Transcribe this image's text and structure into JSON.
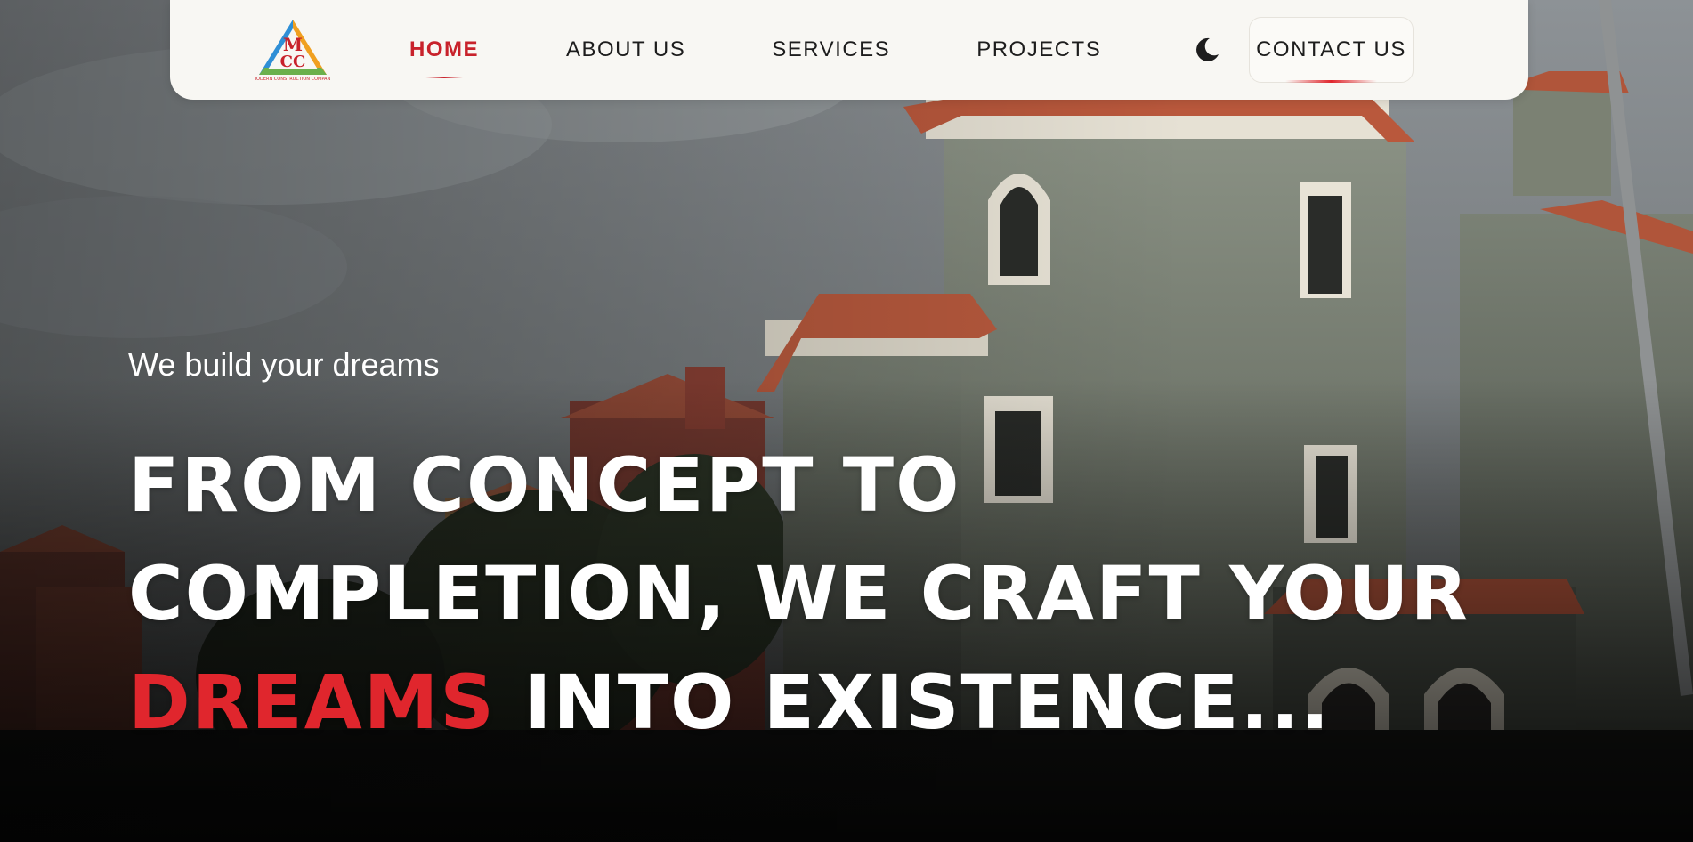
{
  "brand": {
    "logo_letters": "MCC",
    "logo_caption": "MODERN CONSTRUCTION COMPANY"
  },
  "nav": {
    "items": [
      {
        "label": "HOME",
        "active": true
      },
      {
        "label": "ABOUT US",
        "active": false
      },
      {
        "label": "SERVICES",
        "active": false
      },
      {
        "label": "PROJECTS",
        "active": false
      }
    ],
    "theme_toggle_icon": "moon-icon",
    "contact_label": "CONTACT US"
  },
  "hero": {
    "tagline": "We build your dreams",
    "headline_line1": "FROM CONCEPT TO",
    "headline_line2": "COMPLETION, WE CRAFT YOUR",
    "headline_accent": "DREAMS",
    "headline_line3_rest": " INTO EXISTENCE...",
    "background": "photo of terracotta-roofed villa buildings under a cloudy sky"
  },
  "colors": {
    "accent": "#e0262d",
    "nav_active": "#c8222b",
    "nav_background": "#f8f7f3",
    "text_light": "#ffffff",
    "text_dark": "#1d1d1d"
  }
}
